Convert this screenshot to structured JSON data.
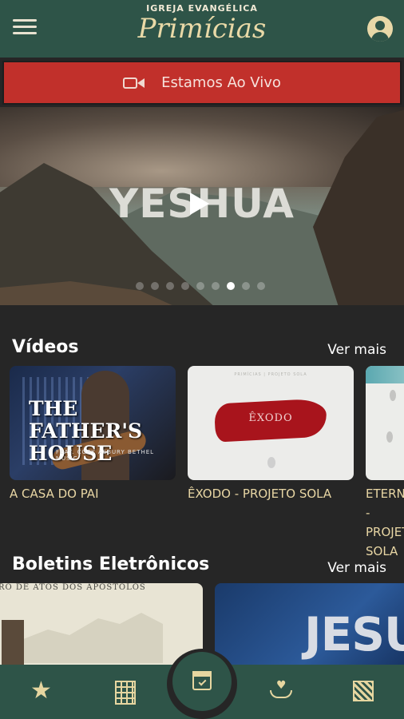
{
  "header": {
    "brand_top": "IGREJA EVANGÉLICA",
    "brand_name": "Primícias"
  },
  "live": {
    "label": "Estamos Ao Vivo"
  },
  "hero": {
    "title": "YESHUA",
    "slide_count": 9,
    "active_slide": 7
  },
  "videos": {
    "title": "Vídeos",
    "see_more": "Ver mais",
    "items": [
      {
        "caption": "A CASA DO PAI",
        "thumb_title": "THE FATHER'S HOUSE",
        "thumb_sub": "FEAT. CORY ASBURY   BETHEL MUSIC"
      },
      {
        "caption": "ÊXODO - PROJETO SOLA",
        "thumb_top": "PRIMÍCIAS | PROJETO SOLA",
        "thumb_title": "ÊXODO"
      },
      {
        "caption": "ETERNO - PROJETO SOLA"
      }
    ]
  },
  "bulletins": {
    "title": "Boletins Eletrônicos",
    "see_more": "Ver mais",
    "items": [
      {
        "text": "RO DE ATOS DOS APÓSTOLOS"
      },
      {
        "text": "JESUS"
      }
    ]
  },
  "colors": {
    "header_bg": "#2e5448",
    "live_bg": "#c1302b",
    "accent_gold": "#e6d6a0",
    "page_bg": "#262626"
  }
}
